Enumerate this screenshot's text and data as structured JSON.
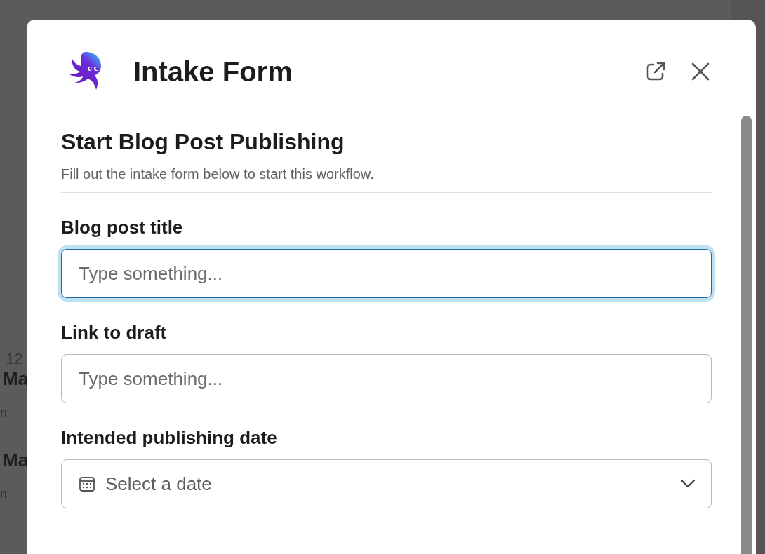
{
  "background": {
    "fragments": [
      "12",
      "Ma",
      "n",
      "Ma",
      "n"
    ]
  },
  "modal": {
    "title": "Intake Form",
    "form": {
      "heading": "Start Blog Post Publishing",
      "description": "Fill out the intake form below to start this workflow.",
      "fields": [
        {
          "kind": "text",
          "label": "Blog post title",
          "placeholder": "Type something...",
          "focused": true
        },
        {
          "kind": "text",
          "label": "Link to draft",
          "placeholder": "Type something...",
          "focused": false
        },
        {
          "kind": "date",
          "label": "Intended publishing date",
          "placeholder": "Select a date",
          "focused": false
        }
      ]
    }
  }
}
